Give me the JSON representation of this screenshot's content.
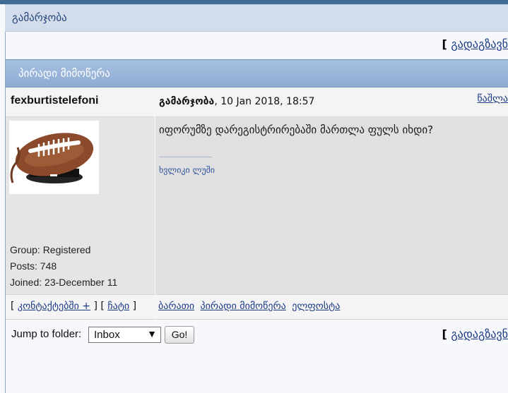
{
  "header": {
    "section_title": "გამარჯობა"
  },
  "top_action": {
    "reply_label": "გადაგზავნ"
  },
  "panel": {
    "title": "პირადი მიმოწერა"
  },
  "message": {
    "author": "fexburtistelefoni",
    "subject": "გამარჯობა",
    "date": ", 10 Jan 2018, 18:57",
    "delete_label": "წაშლა",
    "body": "იფორუმზე დარეგისტრირებაში მართლა ფულს იხდი?",
    "signature_divider": "--------------------",
    "signature": "ხვლიკი ლუში"
  },
  "profile": {
    "group": "Group: Registered",
    "posts": "Posts: 748",
    "joined": "Joined: 23-December 11",
    "avatar_icon": "american-football-phone-icon"
  },
  "contacts": {
    "left_bracket": "[",
    "contacts_label": "კონტაქტებში +",
    "middle_bracket": " ] [",
    "chat_label": "ჩატი",
    "right_bracket": "]"
  },
  "actions": {
    "links": [
      "ბარათი",
      "პირადი მიმოწერა",
      "ელფოსტა"
    ]
  },
  "bottom": {
    "jump_label": "Jump to folder:",
    "folder_value": "Inbox",
    "go_label": "Go!",
    "reply_label": "გადაგზავნ"
  }
}
